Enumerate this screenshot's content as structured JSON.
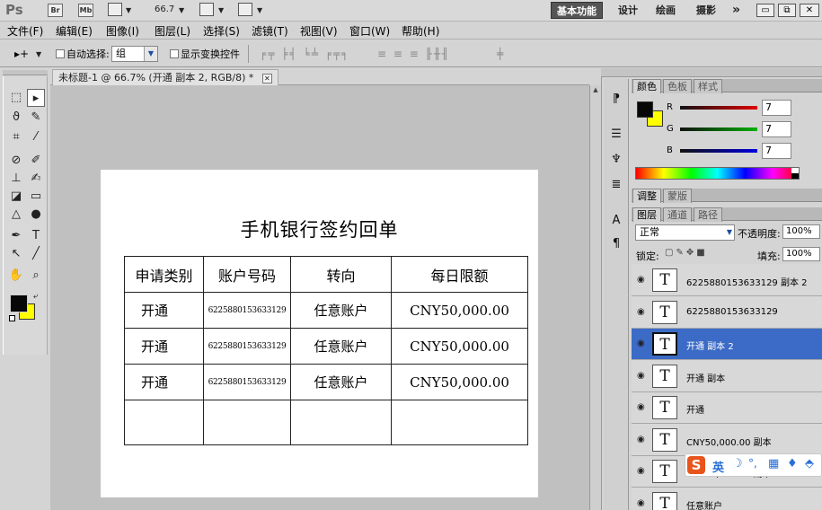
{
  "appbar": {
    "logo": "Ps",
    "br_label": "Br",
    "mb_label": "Mb",
    "zoom": "66.7",
    "dropdown_glyph": "▼",
    "workspaces": [
      "基本功能",
      "设计",
      "绘画",
      "摄影"
    ],
    "more": "»",
    "minimize": "▭",
    "restore": "⧉",
    "close": "✕"
  },
  "menubar": {
    "items": [
      "文件(F)",
      "编辑(E)",
      "图像(I)",
      "图层(L)",
      "选择(S)",
      "滤镜(T)",
      "视图(V)",
      "窗口(W)",
      "帮助(H)"
    ]
  },
  "options": {
    "move_tool_glyph": "▸+",
    "auto_select_label": "自动选择:",
    "auto_select_value": "组",
    "show_transform_label": "显示变换控件",
    "align_glyphs": "╒╤ ╞╡ ╘╧ ╒╤╕",
    "distribute_glyphs": "≡ ≡ ≡ ╟╫╢",
    "auto_align_glyph": "╪"
  },
  "document": {
    "tab_title": "未标题-1 @ 66.7% (开通 副本 2, RGB/8) *",
    "tab_close": "✕",
    "title": "手机银行签约回单",
    "table": {
      "headers": [
        "申请类别",
        "账户号码",
        "转向",
        "每日限额"
      ],
      "rows": [
        [
          "开通",
          "6225880153633129",
          "任意账户",
          "CNY50,000.00"
        ],
        [
          "开通",
          "6225880153633129",
          "任意账户",
          "CNY50,000.00"
        ],
        [
          "开通",
          "6225880153633129",
          "任意账户",
          "CNY50,000.00"
        ],
        [
          "",
          "",
          "",
          ""
        ]
      ]
    }
  },
  "color_panel": {
    "tabs": [
      "颜色",
      "色板",
      "样式"
    ],
    "channels": [
      {
        "label": "R",
        "value": "7",
        "color": "#e00000"
      },
      {
        "label": "G",
        "value": "7",
        "color": "#00b000"
      },
      {
        "label": "B",
        "value": "7",
        "color": "#0000e0"
      }
    ],
    "foreground": "#070707",
    "background": "#ffff00"
  },
  "adjust_panel": {
    "tabs": [
      "调整",
      "蒙版"
    ]
  },
  "layers_panel": {
    "tabs": [
      "图层",
      "通道",
      "路径"
    ],
    "blend_mode": "正常",
    "opacity_label": "不透明度:",
    "opacity_value": "100%",
    "lock_label": "锁定:",
    "fill_label": "填充:",
    "fill_value": "100%",
    "layers": [
      {
        "name": "6225880153633129 副本 2",
        "selected": false
      },
      {
        "name": "6225880153633129",
        "selected": false
      },
      {
        "name": "开通 副本 2",
        "selected": true
      },
      {
        "name": "开通 副本",
        "selected": false
      },
      {
        "name": "开通",
        "selected": false
      },
      {
        "name": "CNY50,000.00 副本",
        "selected": false
      },
      {
        "name": "CNY50,000.00 副本 2",
        "selected": false
      },
      {
        "name": "任意账户",
        "selected": false
      }
    ]
  },
  "ime": {
    "logo": "S",
    "lang": "英"
  }
}
